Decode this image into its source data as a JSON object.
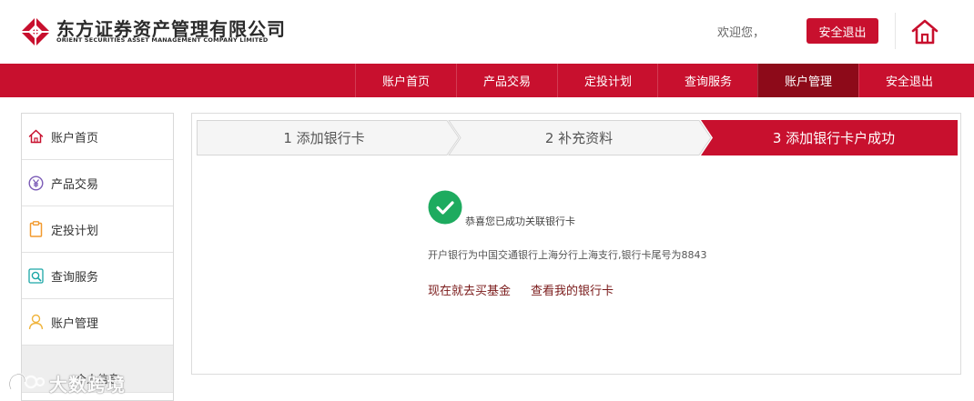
{
  "header": {
    "logo_cn": "东方证券资产管理有限公司",
    "logo_en": "ORIENT SECURITIES ASSET MANAGEMENT COMPANY LIMITED",
    "welcome": "欢迎您，",
    "logout_label": "安全退出",
    "home_icon": "home-icon"
  },
  "nav": {
    "items": [
      {
        "label": "账户首页"
      },
      {
        "label": "产品交易"
      },
      {
        "label": "定投计划"
      },
      {
        "label": "查询服务"
      },
      {
        "label": "账户管理"
      },
      {
        "label": "安全退出"
      }
    ],
    "active": "账户管理"
  },
  "sidebar": {
    "items": [
      {
        "label": "账户首页",
        "icon": "house-icon"
      },
      {
        "label": "产品交易",
        "icon": "yen-icon"
      },
      {
        "label": "定投计划",
        "icon": "clipboard-icon"
      },
      {
        "label": "查询服务",
        "icon": "magnifier-icon"
      },
      {
        "label": "账户管理",
        "icon": "user-icon"
      }
    ],
    "sub_items": [
      {
        "label": "个人信息"
      }
    ]
  },
  "steps": [
    {
      "label": "1 添加银行卡",
      "state": "done"
    },
    {
      "label": "2 补充资料",
      "state": "done"
    },
    {
      "label": "3 添加银行卡户成功",
      "state": "current"
    }
  ],
  "result": {
    "icon": "check-circle-icon",
    "message": "恭喜您已成功关联银行卡",
    "detail": "开户银行为中国交通银行上海分行上海支行,银行卡尾号为8843",
    "link_buy": "现在就去买基金",
    "link_cards": "查看我的银行卡"
  },
  "watermark": {
    "text": "大数跨境"
  },
  "colors": {
    "brand_red": "#c8102e",
    "nav_active": "#8d0a19",
    "success_green": "#1eab5f",
    "link_color": "#7a1a1a"
  }
}
